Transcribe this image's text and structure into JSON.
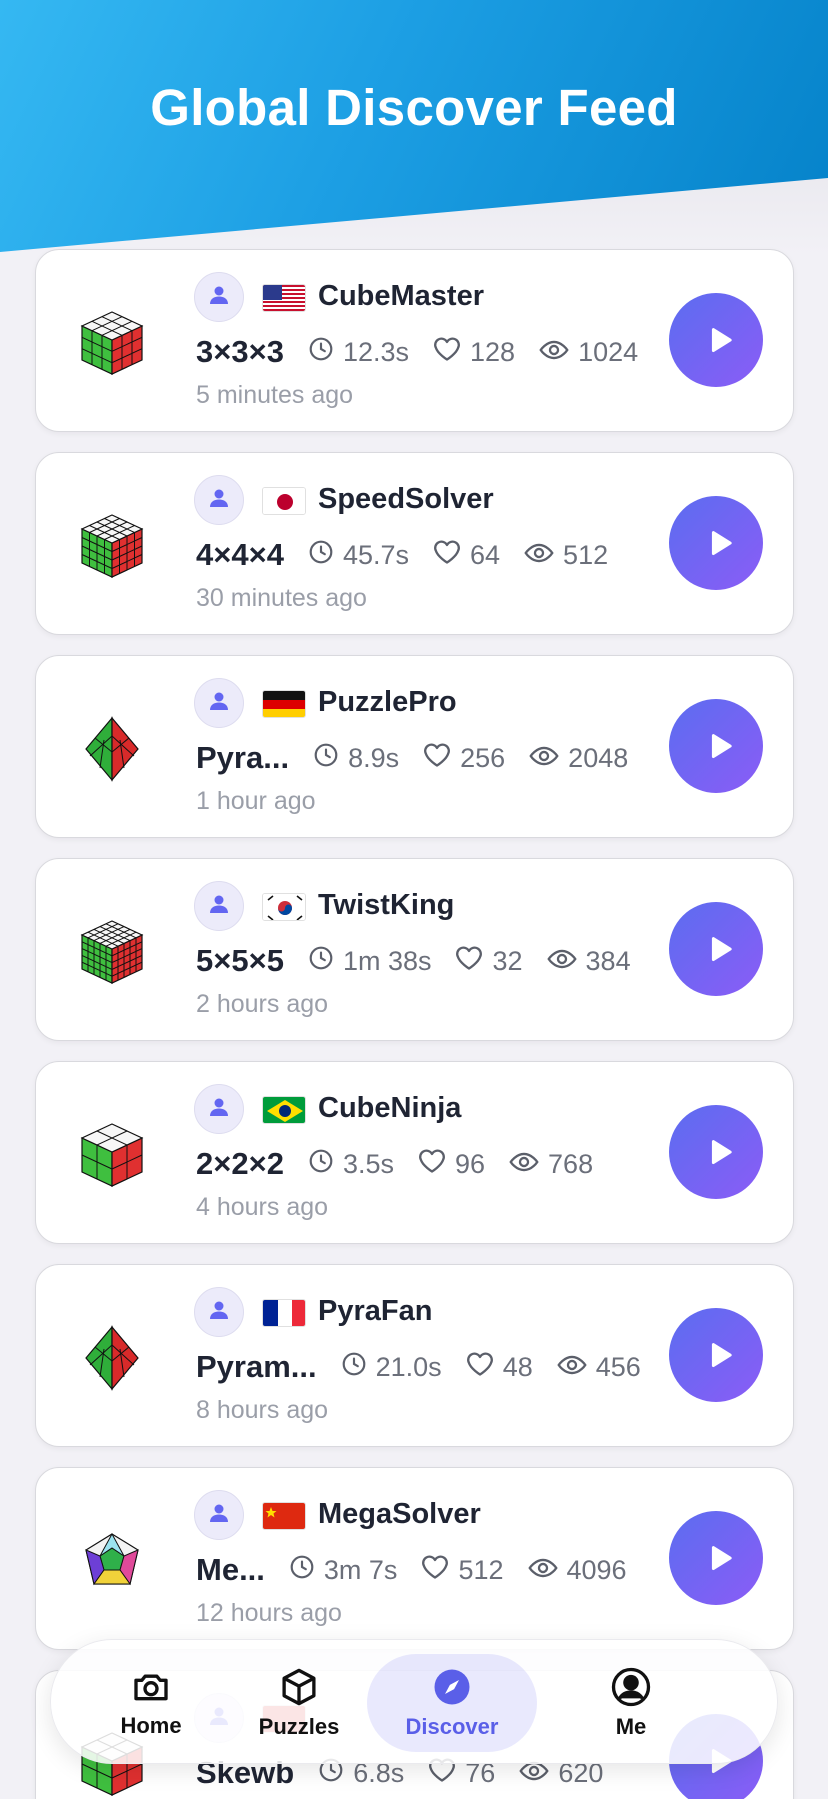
{
  "header": {
    "title": "Global Discover Feed"
  },
  "colors": {
    "accent": "#6366f1",
    "header_blue": "#1c9ee3",
    "play_gradient_start": "#5b6df0",
    "play_gradient_end": "#8b5cf6"
  },
  "feed": [
    {
      "user": "CubeMaster",
      "flag": "us",
      "puzzle": "3×3×3",
      "puzzle_icon": "cube-3x3-icon",
      "time": "12.3s",
      "likes": "128",
      "views": "1024",
      "ago": "5 minutes ago"
    },
    {
      "user": "SpeedSolver",
      "flag": "jp",
      "puzzle": "4×4×4",
      "puzzle_icon": "cube-4x4-icon",
      "time": "45.7s",
      "likes": "64",
      "views": "512",
      "ago": "30 minutes ago"
    },
    {
      "user": "PuzzlePro",
      "flag": "de",
      "puzzle": "Pyra...",
      "puzzle_icon": "pyraminx-icon",
      "time": "8.9s",
      "likes": "256",
      "views": "2048",
      "ago": "1 hour ago"
    },
    {
      "user": "TwistKing",
      "flag": "kr",
      "puzzle": "5×5×5",
      "puzzle_icon": "cube-5x5-icon",
      "time": "1m 38s",
      "likes": "32",
      "views": "384",
      "ago": "2 hours ago"
    },
    {
      "user": "CubeNinja",
      "flag": "br",
      "puzzle": "2×2×2",
      "puzzle_icon": "cube-2x2-icon",
      "time": "3.5s",
      "likes": "96",
      "views": "768",
      "ago": "4 hours ago"
    },
    {
      "user": "PyraFan",
      "flag": "fr",
      "puzzle": "Pyram...",
      "puzzle_icon": "pyraminx-icon",
      "time": "21.0s",
      "likes": "48",
      "views": "456",
      "ago": "8 hours ago"
    },
    {
      "user": "MegaSolver",
      "flag": "cn",
      "puzzle": "Me...",
      "puzzle_icon": "megaminx-icon",
      "time": "3m 7s",
      "likes": "512",
      "views": "4096",
      "ago": "12 hours ago"
    },
    {
      "user": "",
      "flag": "",
      "puzzle": "Skewb",
      "puzzle_icon": "skewb-icon",
      "time": "6.8s",
      "likes": "76",
      "views": "620",
      "ago": ""
    }
  ],
  "nav": {
    "active": "discover",
    "items": [
      {
        "id": "home",
        "label": "Home",
        "icon": "camera-icon"
      },
      {
        "id": "puzzles",
        "label": "Puzzles",
        "icon": "cube-outline-icon"
      },
      {
        "id": "discover",
        "label": "Discover",
        "icon": "compass-icon"
      },
      {
        "id": "me",
        "label": "Me",
        "icon": "user-circle-icon"
      }
    ]
  }
}
